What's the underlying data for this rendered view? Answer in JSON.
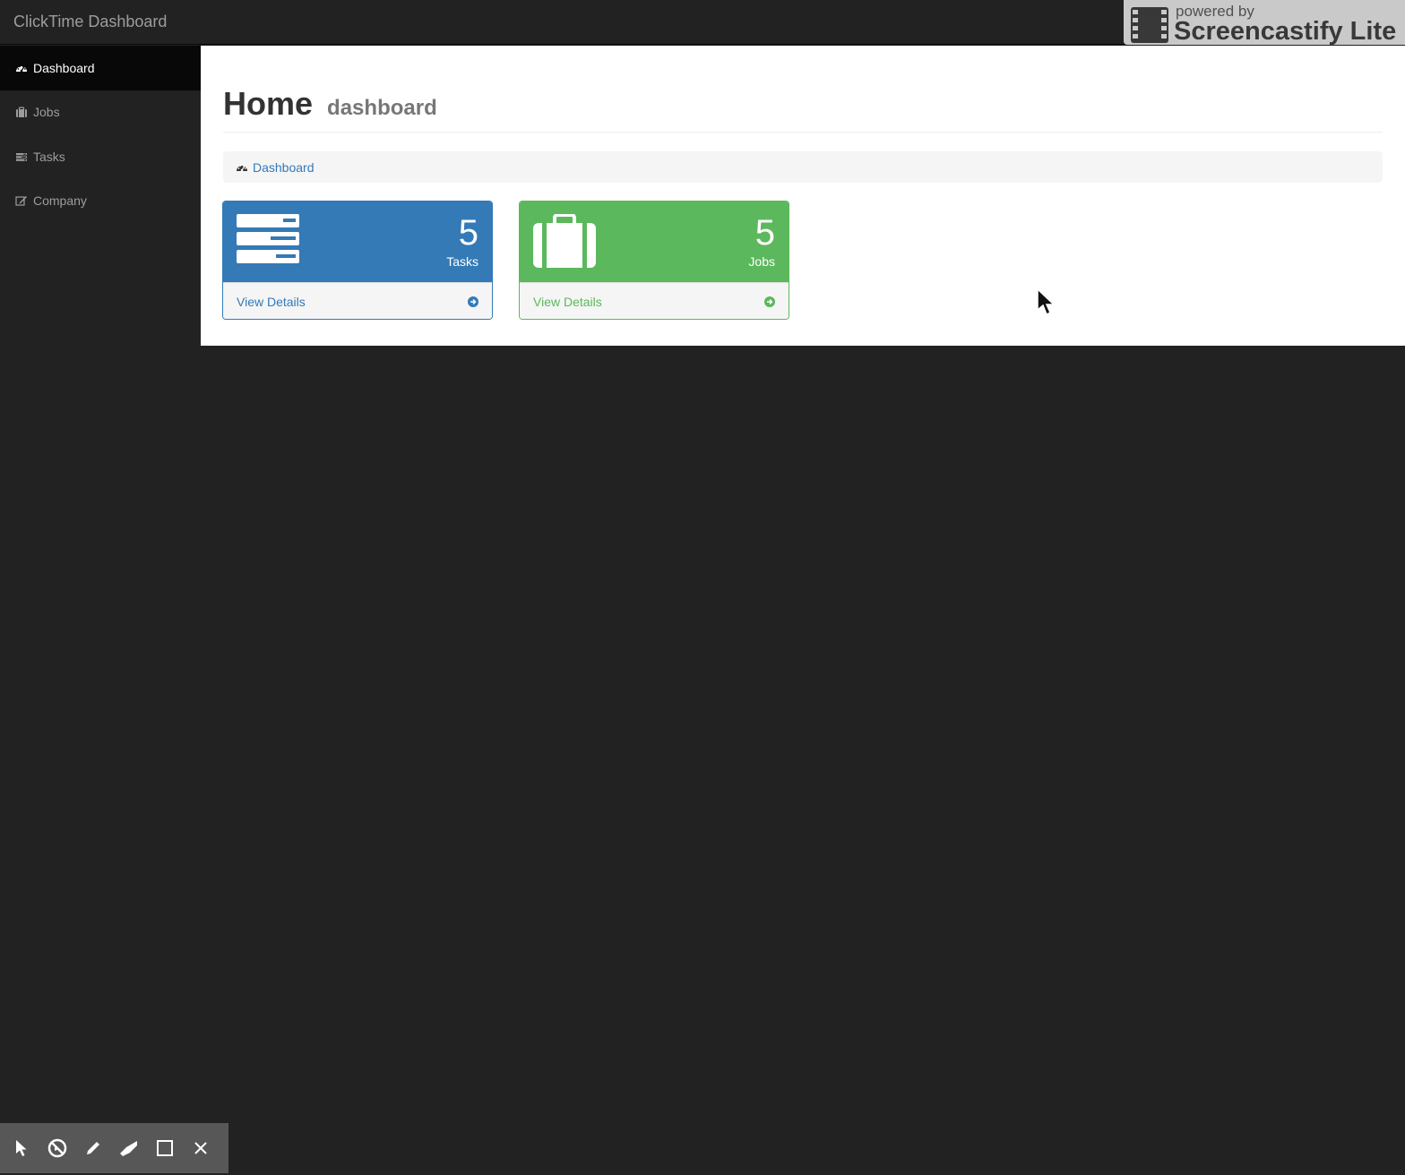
{
  "navbar": {
    "brand": "ClickTime Dashboard"
  },
  "watermark": {
    "small_text": "powered by",
    "big_text": "Screencastify Lite"
  },
  "sidebar": {
    "items": [
      {
        "label": "Dashboard",
        "icon": "dashboard-icon",
        "active": true
      },
      {
        "label": "Jobs",
        "icon": "briefcase-icon",
        "active": false
      },
      {
        "label": "Tasks",
        "icon": "tasks-icon",
        "active": false
      },
      {
        "label": "Company",
        "icon": "edit-icon",
        "active": false
      }
    ]
  },
  "page": {
    "title": "Home",
    "subtitle": "dashboard",
    "breadcrumb": {
      "icon": "dashboard-icon",
      "label": "Dashboard"
    }
  },
  "panels": [
    {
      "count": "5",
      "label": "Tasks",
      "footer": "View Details",
      "icon": "tasks-icon",
      "color": "#337ab7"
    },
    {
      "count": "5",
      "label": "Jobs",
      "footer": "View Details",
      "icon": "briefcase-icon",
      "color": "#5cb85c"
    }
  ],
  "toolbar": {
    "tools": [
      "pointer-icon",
      "no-record-icon",
      "pencil-icon",
      "eraser-icon",
      "rectangle-icon",
      "close-icon"
    ]
  },
  "colors": {
    "primary": "#337ab7",
    "success": "#5cb85c",
    "navbar": "#222222"
  }
}
